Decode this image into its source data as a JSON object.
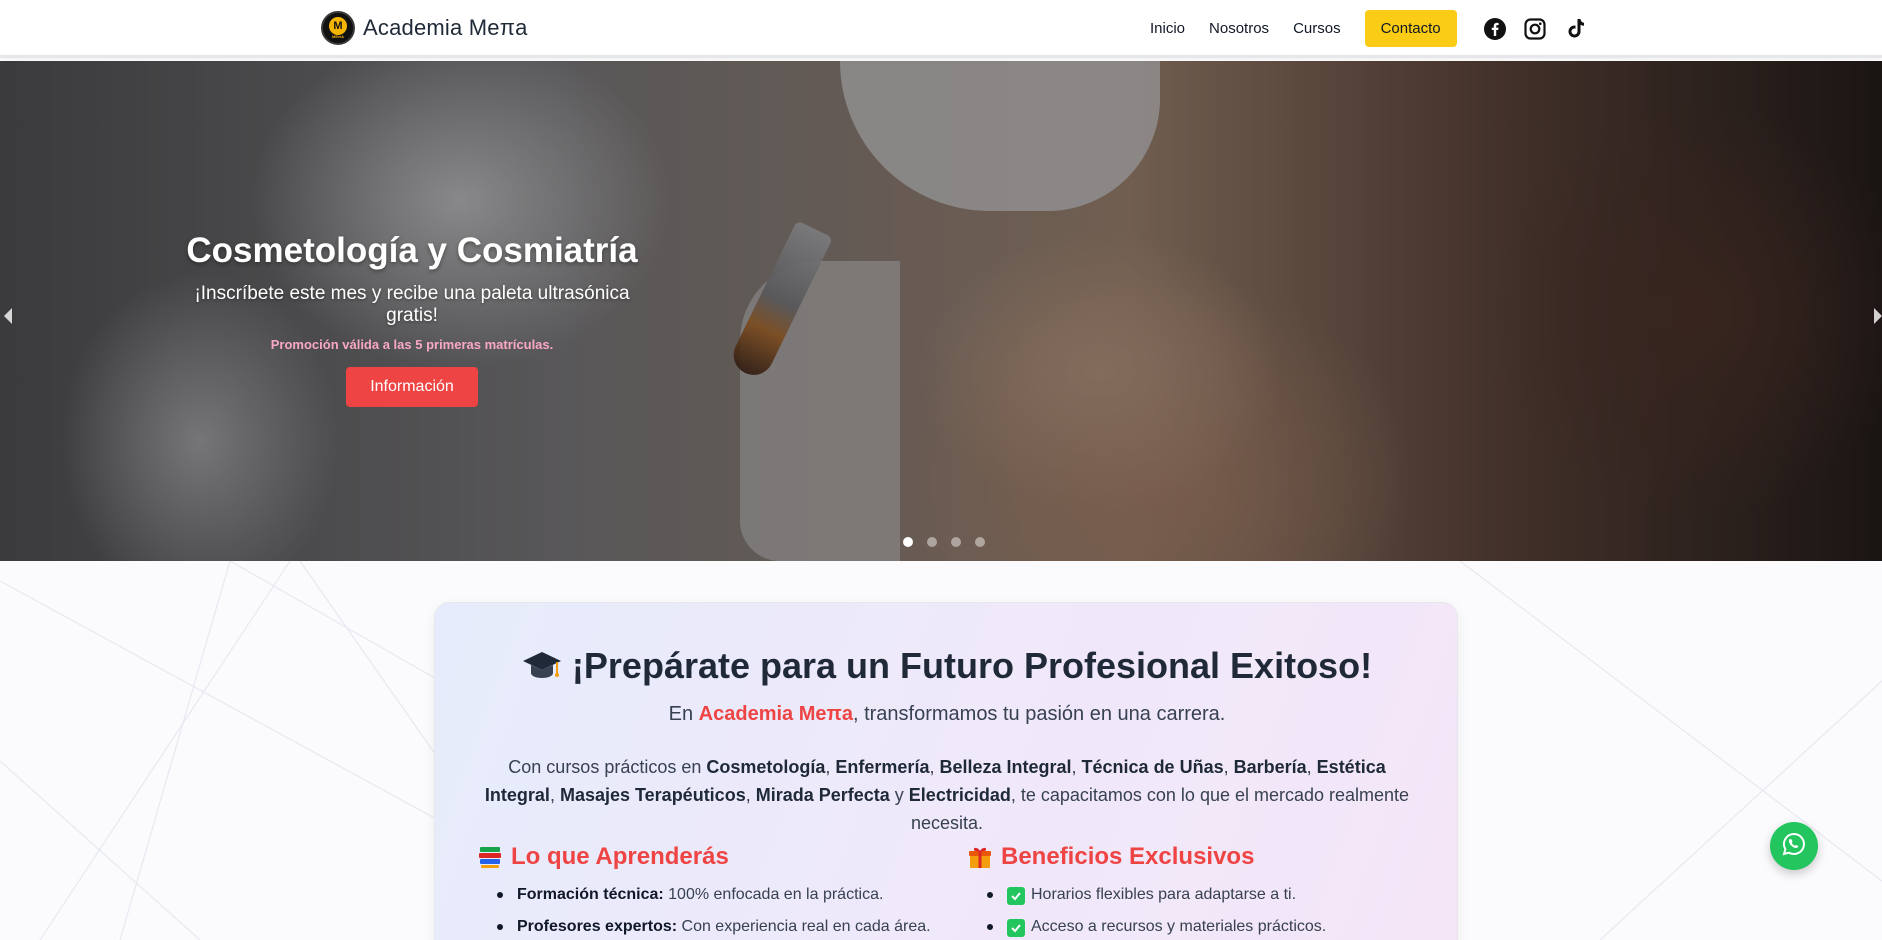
{
  "brand": {
    "name": "Academia Meπa",
    "logo_text": "MEπA"
  },
  "nav": {
    "items": [
      {
        "label": "Inicio"
      },
      {
        "label": "Nosotros"
      },
      {
        "label": "Cursos"
      }
    ],
    "cta_label": "Contacto",
    "social_icons": [
      "facebook-icon",
      "instagram-icon",
      "tiktok-icon"
    ]
  },
  "hero": {
    "title": "Cosmetología y Cosmiatría",
    "subtitle": "¡Inscríbete este mes y recibe una paleta ultrasónica gratis!",
    "promo": "Promoción válida a las 5 primeras matrículas.",
    "button_label": "Información",
    "slides_total": 4,
    "active_slide": 1
  },
  "intro": {
    "icon": "graduation-cap-icon",
    "title": "¡Prepárate para un Futuro Profesional Exitoso!",
    "lead_prefix": "En ",
    "lead_brand": "Academia Meπa",
    "lead_suffix": ", transformamos tu pasión en una carrera.",
    "desc": {
      "prefix": "Con cursos prácticos en ",
      "courses": [
        "Cosmetología",
        "Enfermería",
        "Belleza Integral",
        "Técnica de Uñas",
        "Barbería",
        "Estética Integral",
        "Masajes Terapéuticos",
        "Mirada Perfecta"
      ],
      "sep_comma": ", ",
      "sep_and": " y ",
      "last_course": "Electricidad",
      "suffix": ", te capacitamos con lo que el mercado realmente necesita."
    },
    "learn": {
      "icon": "books-icon",
      "title": "Lo que Aprenderás",
      "items": [
        {
          "bold": "Formación técnica:",
          "text": " 100% enfocada en la práctica."
        },
        {
          "bold": "Profesores expertos:",
          "text": " Con experiencia real en cada área."
        }
      ]
    },
    "benefits": {
      "icon": "gift-icon",
      "title": "Beneficios Exclusivos",
      "items": [
        {
          "text": "Horarios flexibles para adaptarse a ti."
        },
        {
          "text": "Acceso a recursos y materiales prácticos."
        }
      ]
    }
  },
  "colors": {
    "accent": "#ef4444",
    "cta": "#facc15",
    "whatsapp": "#22c55e",
    "promo": "#f9a8c4"
  },
  "whatsapp_icon": "whatsapp-icon"
}
